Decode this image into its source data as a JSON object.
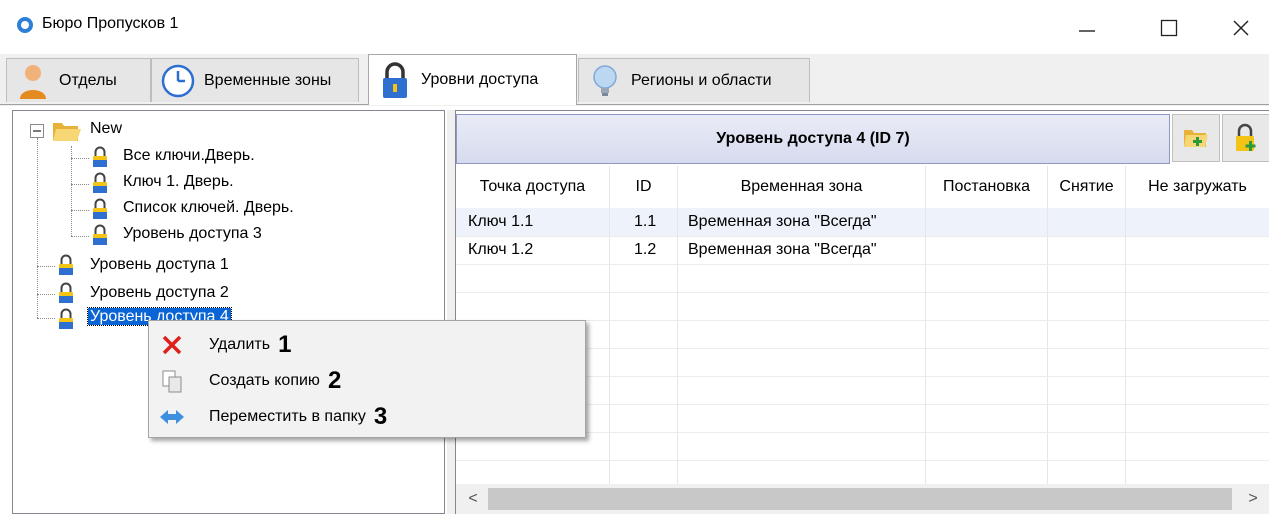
{
  "window": {
    "title": "Бюро Пропусков 1",
    "minimize_label": "—",
    "maximize_label": "☐",
    "close_label": "✕"
  },
  "tabs": [
    {
      "label": "Отделы",
      "icon": "person-icon"
    },
    {
      "label": "Временные зоны",
      "icon": "clock-icon"
    },
    {
      "label": "Уровни доступа",
      "icon": "lock-icon",
      "active": true
    },
    {
      "label": "Регионы и области",
      "icon": "lightbulb-icon"
    }
  ],
  "tree": {
    "folder": "New",
    "folder_children": [
      "Все ключи.Дверь.",
      "Ключ 1. Дверь.",
      "Список ключей. Дверь.",
      "Уровень доступа 3"
    ],
    "items": [
      "Уровень доступа 1",
      "Уровень доступа 2"
    ],
    "selected": "Уровень доступа 4"
  },
  "grid": {
    "header": "Уровень доступа 4 (ID 7)",
    "columns": [
      "Точка доступа",
      "ID",
      "Временная зона",
      "Постановка",
      "Снятие",
      "Не загружать"
    ],
    "rows": [
      [
        "Ключ 1.1",
        "1.1",
        "Временная зона \"Всегда\"",
        "",
        "",
        ""
      ],
      [
        "Ключ 1.2",
        "1.2",
        "Временная зона \"Всегда\"",
        "",
        "",
        ""
      ]
    ]
  },
  "context_menu": {
    "items": [
      {
        "label": "Удалить",
        "number": "1",
        "icon": "delete-x-icon"
      },
      {
        "label": "Создать копию",
        "number": "2",
        "icon": "copy-icon"
      },
      {
        "label": "Переместить в папку",
        "number": "3",
        "icon": "move-arrows-icon"
      }
    ]
  },
  "scrollbar": {
    "left": "<",
    "right": ">"
  },
  "colors": {
    "accent": "#0a64d6",
    "lock_yellow": "#f3c316",
    "lock_body": "#2f6fcf"
  }
}
